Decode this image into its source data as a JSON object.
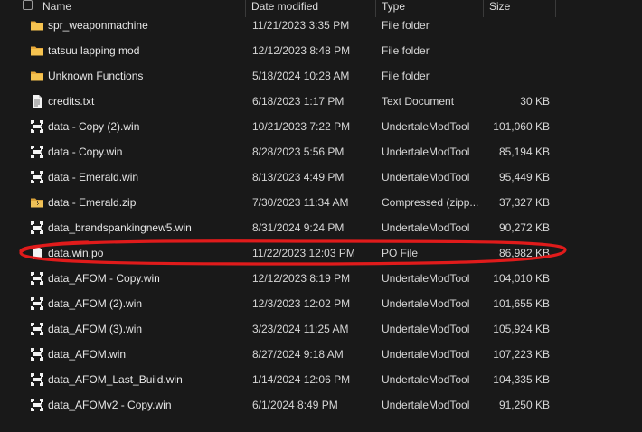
{
  "header": {
    "name_label": "Name",
    "date_label": "Date modified",
    "type_label": "Type",
    "size_label": "Size"
  },
  "files": [
    {
      "name": "spr_weaponmachine",
      "date": "11/21/2023 3:35 PM",
      "type": "File folder",
      "size": "",
      "icon": "folder-icon"
    },
    {
      "name": "tatsuu lapping mod",
      "date": "12/12/2023 8:48 PM",
      "type": "File folder",
      "size": "",
      "icon": "folder-icon"
    },
    {
      "name": "Unknown Functions",
      "date": "5/18/2024 10:28 AM",
      "type": "File folder",
      "size": "",
      "icon": "folder-icon"
    },
    {
      "name": "credits.txt",
      "date": "6/18/2023 1:17 PM",
      "type": "Text Document",
      "size": "30 KB",
      "icon": "text-document-icon"
    },
    {
      "name": "data - Copy (2).win",
      "date": "10/21/2023 7:22 PM",
      "type": "UndertaleModTool",
      "size": "101,060 KB",
      "icon": "undertale-mod-tool-icon"
    },
    {
      "name": "data - Copy.win",
      "date": "8/28/2023 5:56 PM",
      "type": "UndertaleModTool",
      "size": "85,194 KB",
      "icon": "undertale-mod-tool-icon"
    },
    {
      "name": "data - Emerald.win",
      "date": "8/13/2023 4:49 PM",
      "type": "UndertaleModTool",
      "size": "95,449 KB",
      "icon": "undertale-mod-tool-icon"
    },
    {
      "name": "data - Emerald.zip",
      "date": "7/30/2023 11:34 AM",
      "type": "Compressed (zipp...",
      "size": "37,327 KB",
      "icon": "zip-folder-icon"
    },
    {
      "name": "data_brandspankingnew5.win",
      "date": "8/31/2024 9:24 PM",
      "type": "UndertaleModTool",
      "size": "90,272 KB",
      "icon": "undertale-mod-tool-icon"
    },
    {
      "name": "data.win.po",
      "date": "11/22/2023 12:03 PM",
      "type": "PO File",
      "size": "86,982 KB",
      "icon": "blank-file-icon"
    },
    {
      "name": "data_AFOM - Copy.win",
      "date": "12/12/2023 8:19 PM",
      "type": "UndertaleModTool",
      "size": "104,010 KB",
      "icon": "undertale-mod-tool-icon"
    },
    {
      "name": "data_AFOM (2).win",
      "date": "12/3/2023 12:02 PM",
      "type": "UndertaleModTool",
      "size": "101,655 KB",
      "icon": "undertale-mod-tool-icon"
    },
    {
      "name": "data_AFOM (3).win",
      "date": "3/23/2024 11:25 AM",
      "type": "UndertaleModTool",
      "size": "105,924 KB",
      "icon": "undertale-mod-tool-icon"
    },
    {
      "name": "data_AFOM.win",
      "date": "8/27/2024 9:18 AM",
      "type": "UndertaleModTool",
      "size": "107,223 KB",
      "icon": "undertale-mod-tool-icon"
    },
    {
      "name": "data_AFOM_Last_Build.win",
      "date": "1/14/2024 12:06 PM",
      "type": "UndertaleModTool",
      "size": "104,335 KB",
      "icon": "undertale-mod-tool-icon"
    },
    {
      "name": "data_AFOMv2 - Copy.win",
      "date": "6/1/2024 8:49 PM",
      "type": "UndertaleModTool",
      "size": "91,250 KB",
      "icon": "undertale-mod-tool-icon"
    }
  ],
  "annotation": {
    "color": "#e01b1b"
  }
}
